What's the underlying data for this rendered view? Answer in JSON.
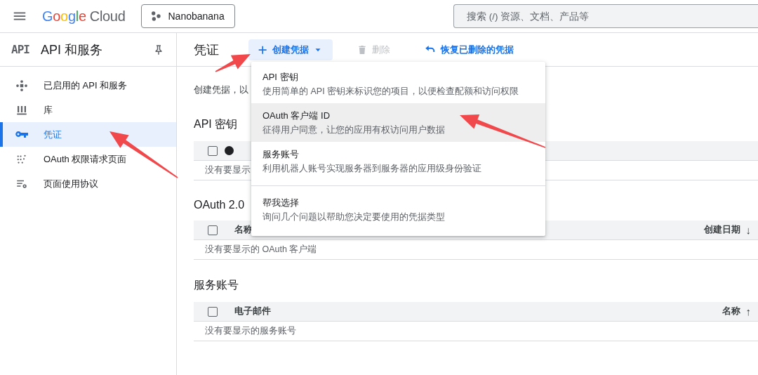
{
  "topbar": {
    "logo": {
      "brand": "Google",
      "product": "Cloud"
    },
    "project": "Nanobanana",
    "search": {
      "placeholder": "搜索 (/) 资源、文档、产品等"
    }
  },
  "sidebar": {
    "badge": "API",
    "title": "API 和服务",
    "items": [
      {
        "label": "已启用的 API 和服务",
        "selected": false
      },
      {
        "label": "库",
        "selected": false
      },
      {
        "label": "凭证",
        "selected": true
      },
      {
        "label": "OAuth 权限请求页面",
        "selected": false
      },
      {
        "label": "页面使用协议",
        "selected": false
      }
    ]
  },
  "toolbar": {
    "title": "凭证",
    "actions": [
      {
        "label": "创建凭据",
        "kind": "create",
        "disabled": false
      },
      {
        "label": "删除",
        "kind": "delete",
        "disabled": true
      },
      {
        "label": "恢复已删除的凭据",
        "kind": "restore",
        "disabled": false
      }
    ]
  },
  "intro": "创建凭据，以",
  "sections": [
    {
      "title": "API 密钥",
      "select_all_checked": false,
      "status_column": true,
      "empty": "没有要显示"
    },
    {
      "title": "OAuth 2.0",
      "select_all_checked": false,
      "status_column": false,
      "columns": [
        {
          "label": "名称"
        },
        {
          "label": "创建日期",
          "sort_icon": "↓"
        }
      ],
      "empty": "没有要显示的 OAuth 客户端"
    },
    {
      "title": "服务账号",
      "select_all_checked": false,
      "status_column": false,
      "columns": [
        {
          "label": "电子邮件"
        },
        {
          "label": "名称",
          "sort_icon": "↑"
        }
      ],
      "empty": "没有要显示的服务账号"
    }
  ],
  "create_menu": {
    "items": [
      {
        "title": "API 密钥",
        "description": "使用简单的 API 密钥来标识您的项目，以便检查配额和访问权限",
        "highlighted": false
      },
      {
        "title": "OAuth 客户端 ID",
        "description": "征得用户同意，让您的应用有权访问用户数据",
        "highlighted": true
      },
      {
        "title": "服务账号",
        "description": "利用机器人账号实现服务器到服务器的应用级身份验证",
        "highlighted": false
      },
      {
        "kind": "divider"
      },
      {
        "title": "帮我选择",
        "description": "询问几个问题以帮助您决定要使用的凭据类型",
        "highlighted": false
      }
    ]
  }
}
